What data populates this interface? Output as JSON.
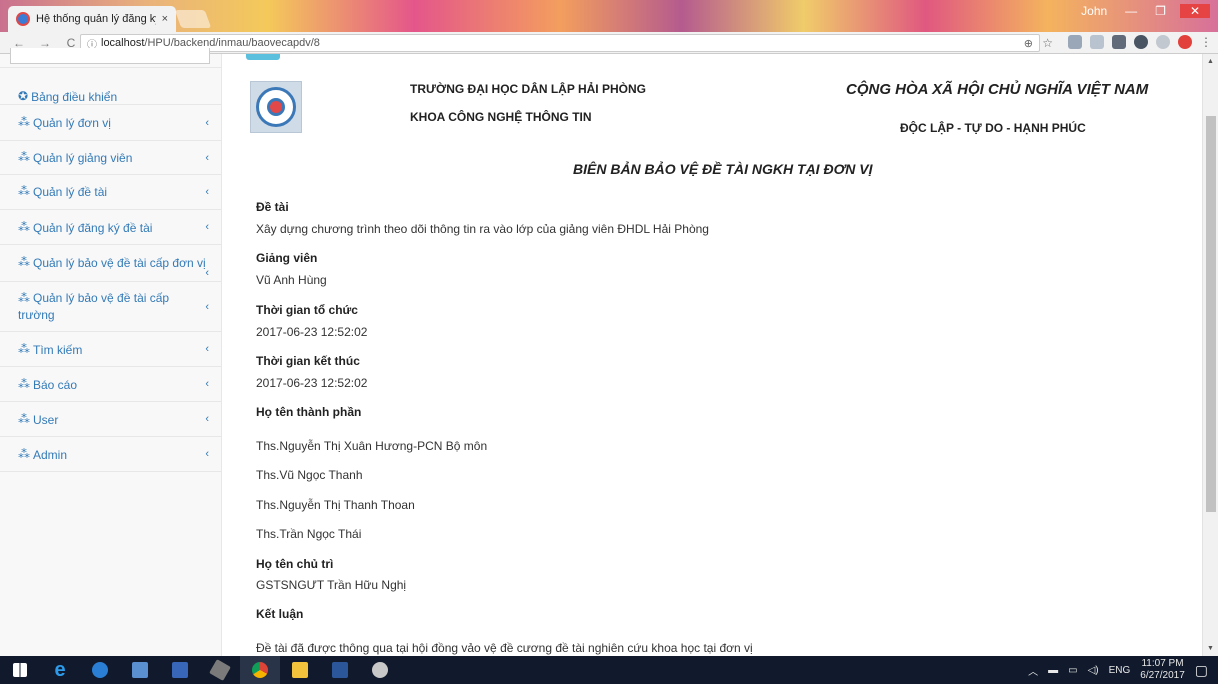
{
  "browser": {
    "tab_title": "Hệ thống quản lý đăng ký",
    "tab_close": "×",
    "user_label": "John",
    "url_host": "localhost",
    "url_path": "/HPU/backend/inmau/baovecapdv/8"
  },
  "sidebar": {
    "items": [
      {
        "label": "Bảng điều khiển",
        "icon": "dashboard-icon",
        "has_chevron": false
      },
      {
        "label": "Quản lý đơn vị",
        "icon": "sitemap-icon",
        "has_chevron": true
      },
      {
        "label": "Quản lý giảng viên",
        "icon": "sitemap-icon",
        "has_chevron": true
      },
      {
        "label": "Quản lý đề tài",
        "icon": "sitemap-icon",
        "has_chevron": true
      },
      {
        "label": "Quản lý đăng ký đề tài",
        "icon": "sitemap-icon",
        "has_chevron": true
      },
      {
        "label": "Quản lý bảo vệ đề tài cấp đơn vị",
        "icon": "sitemap-icon",
        "has_chevron": true
      },
      {
        "label": "Quản lý bảo vệ đề tài cấp trường",
        "icon": "sitemap-icon",
        "has_chevron": true
      },
      {
        "label": "Tìm kiếm",
        "icon": "sitemap-icon",
        "has_chevron": true
      },
      {
        "label": "Báo cáo",
        "icon": "sitemap-icon",
        "has_chevron": true
      },
      {
        "label": "User",
        "icon": "sitemap-icon",
        "has_chevron": true
      },
      {
        "label": "Admin",
        "icon": "sitemap-icon",
        "has_chevron": true
      }
    ],
    "chevron": "‹"
  },
  "header": {
    "school": "TRƯỜNG ĐẠI HỌC DÂN LẬP HẢI PHÒNG",
    "faculty": "KHOA CÔNG NGHỆ THÔNG TIN",
    "republic": "CỘNG HÒA XÃ HỘI CHỦ NGHĨA VIỆT NAM",
    "motto": "ĐỘC LẬP - TỰ DO - HẠNH PHÚC"
  },
  "document": {
    "title": "BIÊN BẢN BẢO VỆ ĐỀ TÀI NGKH TẠI ĐƠN VỊ",
    "topic_label": "Đề tài",
    "topic_value": "Xây dựng chương trình theo dõi thông tin ra vào lớp của giảng viên ĐHDL Hải Phòng",
    "lecturer_label": "Giảng viên",
    "lecturer_value": "Vũ Anh Hùng",
    "start_label": "Thời gian tổ chức",
    "start_value": "2017-06-23 12:52:02",
    "end_label": "Thời gian kết thúc",
    "end_value": "2017-06-23 12:52:02",
    "members_label": "Họ tên thành phần",
    "members": [
      "Ths.Nguyễn Thị Xuân Hương-PCN Bộ môn",
      "Ths.Vũ Ngọc Thanh",
      "Ths.Nguyễn Thị Thanh Thoan",
      "Ths.Trần Ngọc Thái"
    ],
    "chair_label": "Họ tên chủ trì",
    "chair_value": "GSTSNGƯT Trần Hữu Nghị",
    "conclusion_label": "Kết luận",
    "conclusion_value": "Đề tài đã được thông qua tại hội đồng vảo vệ đề cương đề tài nghiên cứu khoa học tại đơn vị"
  },
  "taskbar": {
    "lang": "ENG",
    "time": "11:07 PM",
    "date": "6/27/2017"
  }
}
